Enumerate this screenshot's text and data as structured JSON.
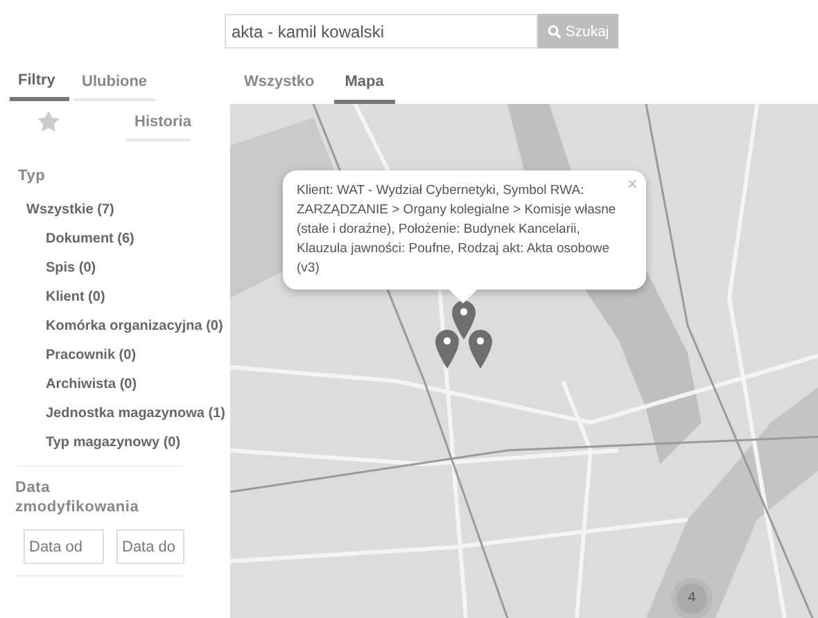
{
  "search": {
    "value": "akta - kamil kowalski",
    "button": "Szukaj"
  },
  "sidebar_tabs": [
    {
      "label": "Filtry",
      "selected": true
    },
    {
      "label": "Ulubione",
      "selected": false
    },
    {
      "label": "Historia",
      "selected": false
    }
  ],
  "filters": {
    "title": "Typ",
    "items": [
      {
        "label": "Wszystkie (7)",
        "children": [
          {
            "label": "Dokument (6)"
          },
          {
            "label": "Spis (0)"
          },
          {
            "label": "Klient (0)"
          },
          {
            "label": "Komórka organizacyjna (0)"
          },
          {
            "label": "Pracownik (0)"
          },
          {
            "label": "Archiwista (0)"
          },
          {
            "label": "Jednostka magazynowa (1)"
          },
          {
            "label": "Typ magazynowy (0)"
          }
        ]
      }
    ]
  },
  "date_filter": {
    "title": "Data zmodyfikowania",
    "from_placeholder": "Data od",
    "to_placeholder": "Data do"
  },
  "view_tabs": [
    {
      "label": "Wszystko",
      "selected": false
    },
    {
      "label": "Mapa",
      "selected": true
    }
  ],
  "map": {
    "popup": {
      "text": "Klient: WAT - Wydział Cybernetyki, Symbol RWA: ZARZĄDZANIE > Organy kolegialne > Komisje własne (stałe i doraźne), Położenie: Budynek Kancelarii, Klauzula jawności: Poufne, Rodzaj akt: Akta osobowe (v3)",
      "close": "×"
    },
    "cluster": {
      "count": "4"
    }
  }
}
